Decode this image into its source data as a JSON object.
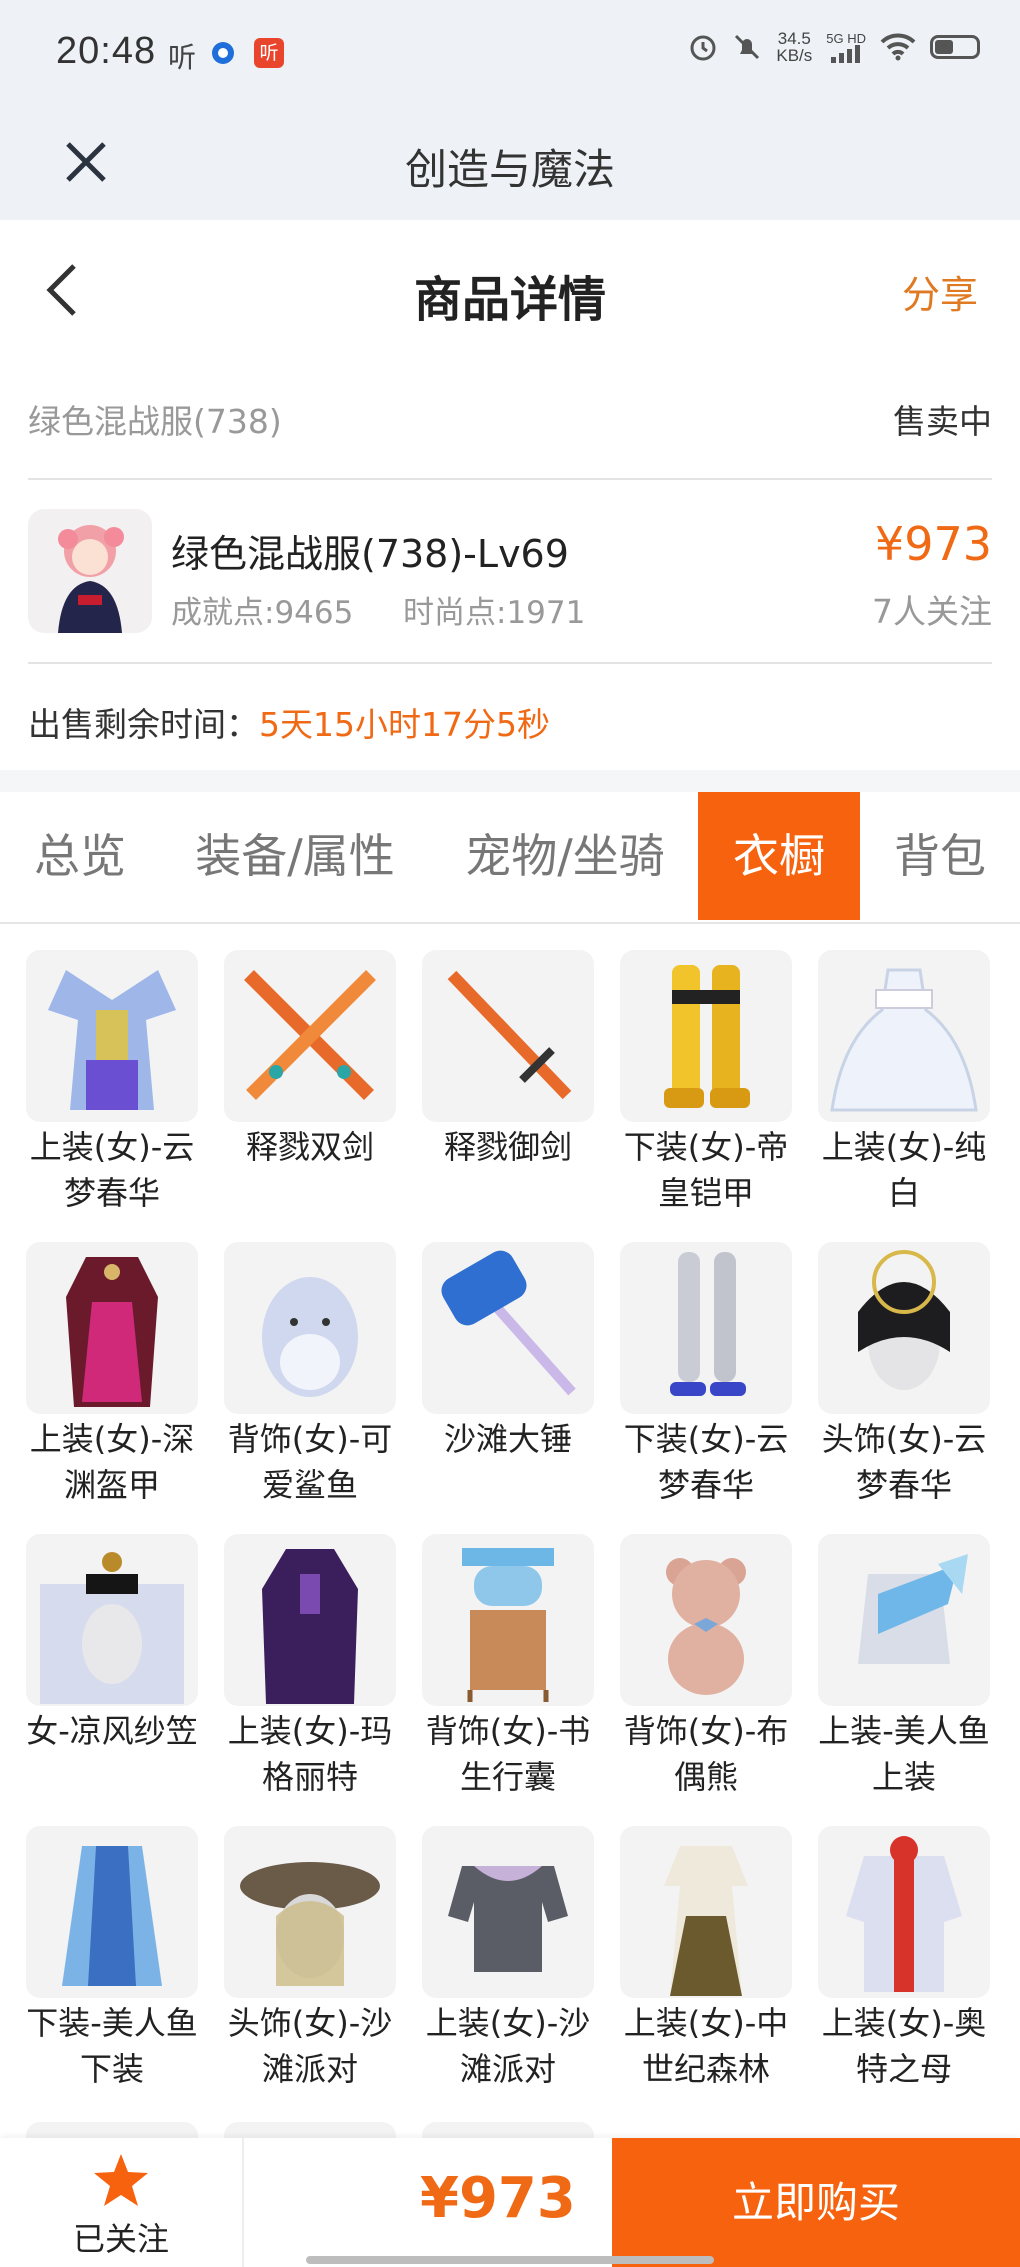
{
  "status_bar": {
    "time": "20:48",
    "left_text": "听",
    "badge_text": "听",
    "speed_value": "34.5",
    "speed_unit": "KB/s",
    "network": "5G HD"
  },
  "app_bar": {
    "title": "创造与魔法",
    "close_icon": "close-icon"
  },
  "header": {
    "title": "商品详情",
    "share_label": "分享",
    "back_icon": "chevron-left-icon"
  },
  "listing": {
    "name": "绿色混战服(738)",
    "status": "售卖中"
  },
  "character": {
    "title": "绿色混战服(738)-Lv69",
    "achievement": "成就点:9465",
    "fashion": "时尚点:1971",
    "price": "¥973",
    "followers": "7人关注"
  },
  "remaining": {
    "label": "出售剩余时间：",
    "value": "5天15小时17分5秒"
  },
  "tabs": [
    {
      "label": "总览",
      "active": false
    },
    {
      "label": "装备/属性",
      "active": false
    },
    {
      "label": "宠物/坐骑",
      "active": false
    },
    {
      "label": "衣橱",
      "active": true
    },
    {
      "label": "背包",
      "active": false
    }
  ],
  "wardrobe": [
    {
      "label": "上装(女)-云梦春华",
      "icon": "costume-top-icon"
    },
    {
      "label": "释戮双剑",
      "icon": "twin-swords-icon"
    },
    {
      "label": "释戮御剑",
      "icon": "sword-icon"
    },
    {
      "label": "下装(女)-帝皇铠甲",
      "icon": "armor-legs-icon"
    },
    {
      "label": "上装(女)-纯白",
      "icon": "white-dress-icon"
    },
    {
      "label": "上装(女)-深渊盔甲",
      "icon": "abyss-armor-icon"
    },
    {
      "label": "背饰(女)-可爱鲨鱼",
      "icon": "shark-backpack-icon"
    },
    {
      "label": "沙滩大锤",
      "icon": "hammer-icon"
    },
    {
      "label": "下装(女)-云梦春华",
      "icon": "legs-icon"
    },
    {
      "label": "头饰(女)-云梦春华",
      "icon": "headpiece-icon"
    },
    {
      "label": "女-凉风纱笠",
      "icon": "veil-hat-icon"
    },
    {
      "label": "上装(女)-玛格丽特",
      "icon": "dark-dress-icon"
    },
    {
      "label": "背饰(女)-书生行囊",
      "icon": "book-pack-icon"
    },
    {
      "label": "背饰(女)-布偶熊",
      "icon": "teddy-bear-icon"
    },
    {
      "label": "上装-美人鱼上装",
      "icon": "mermaid-top-icon"
    },
    {
      "label": "下装-美人鱼下装",
      "icon": "mermaid-skirt-icon"
    },
    {
      "label": "头饰(女)-沙滩派对",
      "icon": "beach-hat-icon"
    },
    {
      "label": "上装(女)-沙滩派对",
      "icon": "beach-top-icon"
    },
    {
      "label": "上装(女)-中世纪森林",
      "icon": "forest-dress-icon"
    },
    {
      "label": "上装(女)-奥特之母",
      "icon": "hero-suit-icon"
    }
  ],
  "bottom_bar": {
    "follow_label": "已关注",
    "price": "¥973",
    "buy_label": "立即购买",
    "star_icon": "star-icon"
  },
  "colors": {
    "accent": "#f7620e",
    "price": "#f06a16",
    "header_bg": "#eef2f6"
  }
}
